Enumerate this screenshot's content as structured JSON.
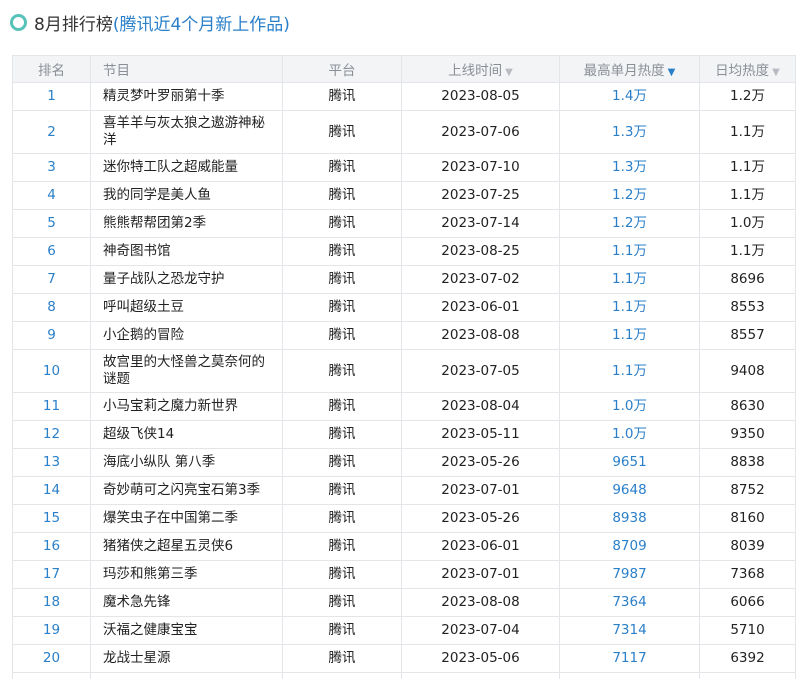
{
  "header": {
    "title": "8月排行榜",
    "subtitle": "(腾讯近4个月新上作品)"
  },
  "columns": {
    "rank": "排名",
    "program": "节目",
    "platform": "平台",
    "launch_time": "上线时间",
    "peak_monthly": "最高单月热度",
    "daily_avg": "日均热度"
  },
  "icons": {
    "sort_inactive": "arrow-down-icon",
    "sort_active": "arrow-down-icon"
  },
  "colors": {
    "accent": "#2a7fc9",
    "circle": "#56c2b8"
  },
  "rows": [
    {
      "rank": "1",
      "program": "精灵梦叶罗丽第十季",
      "platform": "腾讯",
      "date": "2023-08-05",
      "peak": "1.4万",
      "daily": "1.2万"
    },
    {
      "rank": "2",
      "program": "喜羊羊与灰太狼之遨游神秘洋",
      "platform": "腾讯",
      "date": "2023-07-06",
      "peak": "1.3万",
      "daily": "1.1万"
    },
    {
      "rank": "3",
      "program": "迷你特工队之超威能量",
      "platform": "腾讯",
      "date": "2023-07-10",
      "peak": "1.3万",
      "daily": "1.1万"
    },
    {
      "rank": "4",
      "program": "我的同学是美人鱼",
      "platform": "腾讯",
      "date": "2023-07-25",
      "peak": "1.2万",
      "daily": "1.1万"
    },
    {
      "rank": "5",
      "program": "熊熊帮帮团第2季",
      "platform": "腾讯",
      "date": "2023-07-14",
      "peak": "1.2万",
      "daily": "1.0万"
    },
    {
      "rank": "6",
      "program": "神奇图书馆",
      "platform": "腾讯",
      "date": "2023-08-25",
      "peak": "1.1万",
      "daily": "1.1万"
    },
    {
      "rank": "7",
      "program": "量子战队之恐龙守护",
      "platform": "腾讯",
      "date": "2023-07-02",
      "peak": "1.1万",
      "daily": "8696"
    },
    {
      "rank": "8",
      "program": "呼叫超级土豆",
      "platform": "腾讯",
      "date": "2023-06-01",
      "peak": "1.1万",
      "daily": "8553"
    },
    {
      "rank": "9",
      "program": "小企鹅的冒险",
      "platform": "腾讯",
      "date": "2023-08-08",
      "peak": "1.1万",
      "daily": "8557"
    },
    {
      "rank": "10",
      "program": "故宫里的大怪兽之莫奈何的谜题",
      "platform": "腾讯",
      "date": "2023-07-05",
      "peak": "1.1万",
      "daily": "9408"
    },
    {
      "rank": "11",
      "program": "小马宝莉之魔力新世界",
      "platform": "腾讯",
      "date": "2023-08-04",
      "peak": "1.0万",
      "daily": "8630"
    },
    {
      "rank": "12",
      "program": "超级飞侠14",
      "platform": "腾讯",
      "date": "2023-05-11",
      "peak": "1.0万",
      "daily": "9350"
    },
    {
      "rank": "13",
      "program": "海底小纵队 第八季",
      "platform": "腾讯",
      "date": "2023-05-26",
      "peak": "9651",
      "daily": "8838"
    },
    {
      "rank": "14",
      "program": "奇妙萌可之闪亮宝石第3季",
      "platform": "腾讯",
      "date": "2023-07-01",
      "peak": "9648",
      "daily": "8752"
    },
    {
      "rank": "15",
      "program": "爆笑虫子在中国第二季",
      "platform": "腾讯",
      "date": "2023-05-26",
      "peak": "8938",
      "daily": "8160"
    },
    {
      "rank": "16",
      "program": "猪猪侠之超星五灵侠6",
      "platform": "腾讯",
      "date": "2023-06-01",
      "peak": "8709",
      "daily": "8039"
    },
    {
      "rank": "17",
      "program": "玛莎和熊第三季",
      "platform": "腾讯",
      "date": "2023-07-01",
      "peak": "7987",
      "daily": "7368"
    },
    {
      "rank": "18",
      "program": "魔术急先锋",
      "platform": "腾讯",
      "date": "2023-08-08",
      "peak": "7364",
      "daily": "6066"
    },
    {
      "rank": "19",
      "program": "沃福之健康宝宝",
      "platform": "腾讯",
      "date": "2023-07-04",
      "peak": "7314",
      "daily": "5710"
    },
    {
      "rank": "20",
      "program": "龙战士星源",
      "platform": "腾讯",
      "date": "2023-05-06",
      "peak": "7117",
      "daily": "6392"
    }
  ]
}
